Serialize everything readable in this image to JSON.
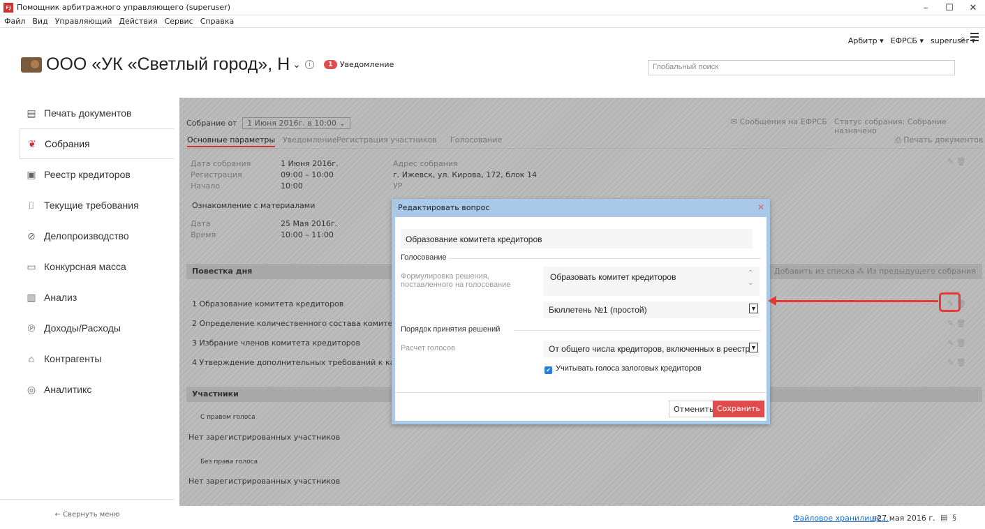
{
  "window": {
    "title": "Помощник арбитражного управляющего (superuser)",
    "app_icon_text": "FJ",
    "controls": [
      "–",
      "☐",
      "✕"
    ]
  },
  "menu": [
    "Файл",
    "Вид",
    "Управляющий",
    "Действия",
    "Сервис",
    "Справка"
  ],
  "header": {
    "top_links": [
      "Арбитр ▾",
      "ЕФРСБ ▾",
      "superuser ▾"
    ],
    "company_name": "ООО «УК «Светлый город», Н",
    "notification_count": "1",
    "notification_label": "Уведомление",
    "search_placeholder": "Глобальный поиск"
  },
  "sidebar": {
    "items": [
      {
        "label": "Печать документов",
        "icon": "document-icon",
        "glyph": "▤"
      },
      {
        "label": "Собрания",
        "icon": "handshake-icon",
        "glyph": "❦"
      },
      {
        "label": "Реестр кредиторов",
        "icon": "register-icon",
        "glyph": "▣"
      },
      {
        "label": "Текущие требования",
        "icon": "requirement-icon",
        "glyph": "⌷"
      },
      {
        "label": "Делопроизводство",
        "icon": "paperclip-icon",
        "glyph": "⊘"
      },
      {
        "label": "Конкурсная масса",
        "icon": "box-icon",
        "glyph": "▭"
      },
      {
        "label": "Анализ",
        "icon": "bar-chart-icon",
        "glyph": "▥"
      },
      {
        "label": "Доходы/Расходы",
        "icon": "income-icon",
        "glyph": "℗"
      },
      {
        "label": "Контрагенты",
        "icon": "bank-icon",
        "glyph": "⌂"
      },
      {
        "label": "Аналитикс",
        "icon": "analytics-icon",
        "glyph": "◎"
      }
    ],
    "collapse_label": "← Свернуть меню"
  },
  "meeting": {
    "label": "Собрание от",
    "selected": "1 Июня 2016г. в 10:00",
    "efrsb_messages": "Сообщения на ЕФРСБ",
    "status": "Статус собрания: Собрание назначено",
    "tabs": [
      "Основные параметры",
      "Уведомление",
      "Регистрация участников",
      "Голосование"
    ],
    "print_label": "Печать документов",
    "details": {
      "date_label": "Дата собрания",
      "date": "1 Июня 2016г.",
      "reg_label": "Регистрация",
      "reg": "09:00 – 10:00",
      "start_label": "Начало",
      "start": "10:00",
      "address_label": "Адрес собрания",
      "address": "г. Ижевск, ул. Кирова, 172, блок 14",
      "address_extra": "УР",
      "materials_title": "Ознакомление с материалами",
      "mdate_label": "Дата",
      "mdate": "25 Мая 2016г.",
      "mtime_label": "Время",
      "mtime": "10:00 – 11:00"
    },
    "agenda": {
      "title": "Повестка дня",
      "add_from_list": "Добавить из списка",
      "from_previous": "Из предыдущего собрания",
      "items": [
        "1   Образование комитета кредиторов",
        "2   Определение количественного состава комитета",
        "3   Избрание членов комитета кредиторов",
        "4   Утверждение дополнительных требований к канд"
      ]
    },
    "participants": {
      "title": "Участники",
      "with_vote": "С правом голоса",
      "none1": "Нет зарегистрированных участников",
      "without_vote": "Без права голоса",
      "none2": "Нет зарегистрированных участников"
    }
  },
  "dialog": {
    "title": "Редактировать вопрос",
    "question": "Образование комитета кредиторов",
    "voting_section": "Голосование",
    "formulation_label": "Формулировка решения, поставленного на голосование",
    "formulation_value": "Образовать комитет кредиторов",
    "ballot": "Бюллетень №1 (простой)",
    "decision_section": "Порядок принятия решений",
    "calc_label": "Расчет голосов",
    "calc_value": "От общего числа кредиторов, включенных в реестр",
    "checkbox_label": "Учитывать голоса залоговых кредиторов",
    "checkbox_checked": true,
    "cancel": "Отменить",
    "save": "Сохранить"
  },
  "status": {
    "storage_link": "Файловое хранилище...",
    "date": "27 мая 2016 г.",
    "section_symbol": "§"
  }
}
